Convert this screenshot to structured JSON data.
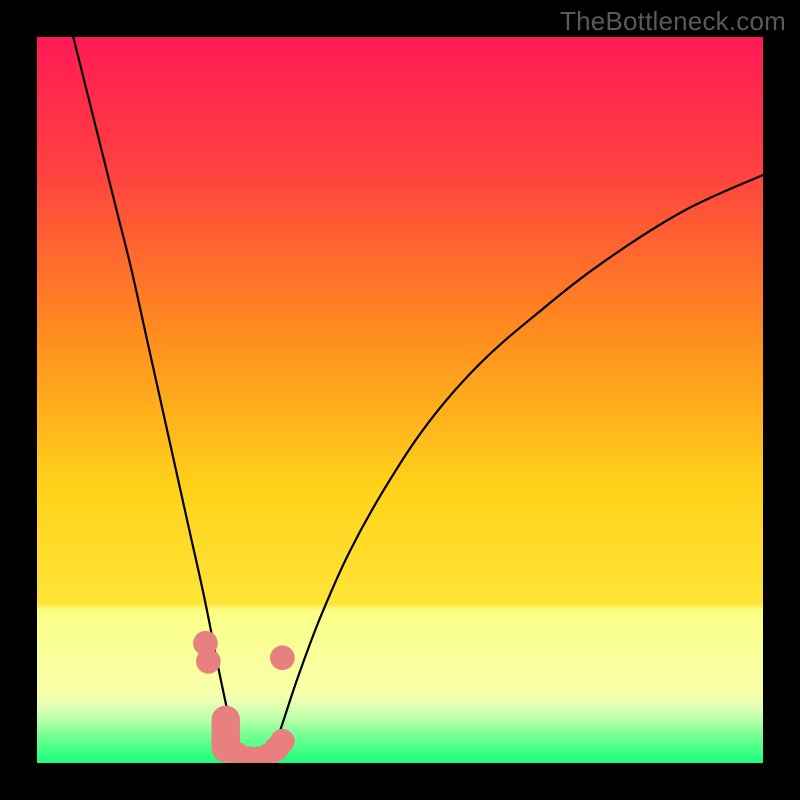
{
  "watermark": "TheBottleneck.com",
  "chart_data": {
    "type": "line",
    "title": "",
    "xlabel": "",
    "ylabel": "",
    "xlim": [
      0,
      100
    ],
    "ylim": [
      0,
      100
    ],
    "background_gradient": {
      "top": "#ff1a55",
      "mid_upper": "#ff8a1f",
      "mid": "#ffe437",
      "lower_band": "#fbff87",
      "bottom": "#19ff7a"
    },
    "series": [
      {
        "name": "curve-left",
        "x": [
          5,
          7,
          9,
          11,
          13,
          15,
          17,
          19,
          21,
          23,
          25,
          26.5,
          28
        ],
        "y": [
          100,
          92,
          84,
          76,
          68,
          59,
          50,
          41,
          32,
          23,
          13,
          6,
          0
        ]
      },
      {
        "name": "curve-right",
        "x": [
          32,
          34,
          36,
          39,
          43,
          48,
          54,
          61,
          69,
          78,
          89,
          100
        ],
        "y": [
          0,
          6,
          12,
          20,
          29,
          38,
          47,
          55,
          62,
          69,
          76,
          81
        ]
      }
    ],
    "markers": [
      {
        "x": 23.2,
        "y": 16.5,
        "r": 1.7,
        "shape": "circle"
      },
      {
        "x": 23.6,
        "y": 14.0,
        "r": 1.7,
        "shape": "circle"
      },
      {
        "x": 26.0,
        "y": 4.0,
        "r": 2.3,
        "shape": "pill-v"
      },
      {
        "x": 27.5,
        "y": 1.2,
        "r": 1.7,
        "shape": "circle"
      },
      {
        "x": 29.2,
        "y": 0.6,
        "r": 1.7,
        "shape": "circle"
      },
      {
        "x": 30.6,
        "y": 0.6,
        "r": 1.7,
        "shape": "circle"
      },
      {
        "x": 31.8,
        "y": 1.0,
        "r": 1.7,
        "shape": "circle"
      },
      {
        "x": 33.0,
        "y": 2.0,
        "r": 1.7,
        "shape": "circle"
      },
      {
        "x": 33.8,
        "y": 3.0,
        "r": 1.7,
        "shape": "circle"
      },
      {
        "x": 33.8,
        "y": 14.5,
        "r": 1.7,
        "shape": "circle"
      }
    ],
    "marker_color": "#e98080"
  }
}
